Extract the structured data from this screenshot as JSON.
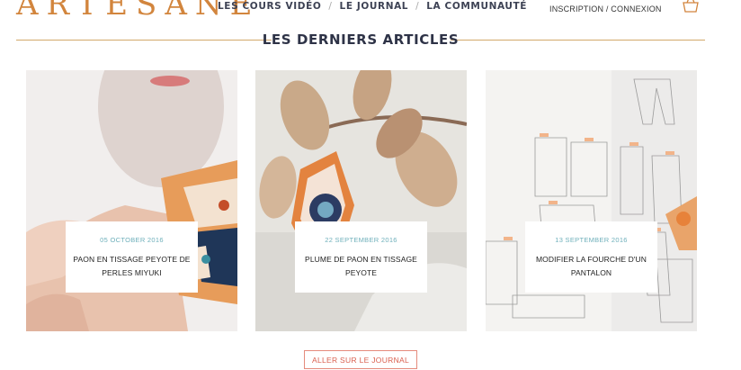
{
  "header": {
    "logo": "ARTESANE",
    "nav": [
      "LES COURS VIDÉO",
      "LE JOURNAL",
      "LA COMMUNAUTÉ"
    ],
    "nav_separator": "/",
    "login": "INSCRIPTION / CONNEXION",
    "cart_icon": "basket-icon"
  },
  "section": {
    "title": "LES DERNIERS ARTICLES"
  },
  "articles": [
    {
      "date": "05 OCTOBER 2016",
      "title": "PAON EN TISSAGE PEYOTE DE PERLES MIYUKI"
    },
    {
      "date": "22 SEPTEMBER 2016",
      "title": "PLUME DE PAON EN TISSAGE PEYOTE"
    },
    {
      "date": "13 SEPTEMBER 2016",
      "title": "MODIFIER LA FOURCHE D'UN PANTALON"
    }
  ],
  "cta": {
    "label": "ALLER SUR LE JOURNAL"
  },
  "colors": {
    "brand": "#d2853d",
    "accent_line": "#d2a86a",
    "date": "#6fb0bb",
    "cta": "#d95f4e"
  }
}
